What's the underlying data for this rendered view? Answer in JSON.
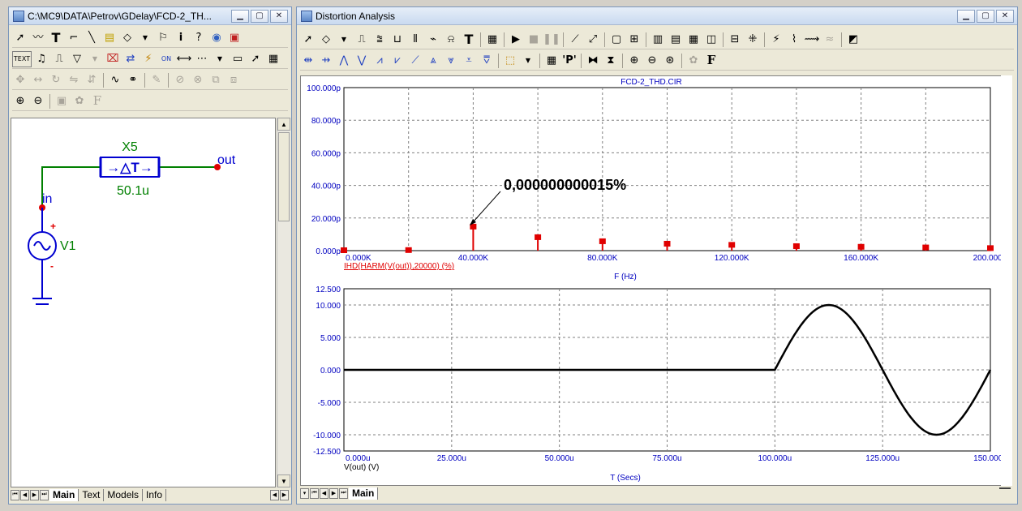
{
  "left_window": {
    "title": "C:\\MC9\\DATA\\Petrov\\GDelay\\FCD-2_TH...",
    "toolbar_text_btn": "TEXT",
    "schematic": {
      "component_name": "X5",
      "component_value": "50.1u",
      "node_in": "in",
      "node_out": "out",
      "source_name": "V1",
      "plus": "+",
      "minus": "-"
    },
    "tabs": [
      "Main",
      "Text",
      "Models",
      "Info"
    ]
  },
  "right_window": {
    "title": "Distortion Analysis",
    "tabs": [
      "Main"
    ]
  },
  "chart_data": [
    {
      "type": "bar",
      "title": "FCD-2_THD.CIR",
      "xlabel": "F (Hz)",
      "trace_label": "IHD(HARM(V(out)),20000) (%)",
      "ylim": [
        0,
        100
      ],
      "xlim": [
        0,
        200000
      ],
      "yticks": [
        "100.000p",
        "80.000p",
        "60.000p",
        "40.000p",
        "20.000p",
        "0.000p"
      ],
      "xticks": [
        "0.000K",
        "40.000K",
        "80.000K",
        "120.000K",
        "160.000K",
        "200.000K"
      ],
      "x": [
        0,
        20000,
        40000,
        60000,
        80000,
        100000,
        120000,
        140000,
        160000,
        180000,
        200000
      ],
      "values": [
        0.5,
        0.6,
        15,
        8.5,
        6,
        4.5,
        3.8,
        3,
        2.6,
        2.2,
        1.8
      ],
      "annotation": "0,000000000015%",
      "color": "#e00000"
    },
    {
      "type": "line",
      "xlabel": "T (Secs)",
      "trace_label": "V(out) (V)",
      "ylim": [
        -12.5,
        12.5
      ],
      "xlim": [
        0,
        150
      ],
      "yticks": [
        "12.500",
        "10.000",
        "5.000",
        "0.000",
        "-5.000",
        "-10.000",
        "-12.500"
      ],
      "xticks": [
        "0.000u",
        "25.000u",
        "50.000u",
        "75.000u",
        "100.000u",
        "125.000u",
        "150.000u"
      ],
      "delay_us": 100,
      "amplitude": 10,
      "period_us": 50,
      "color": "#000000"
    }
  ]
}
